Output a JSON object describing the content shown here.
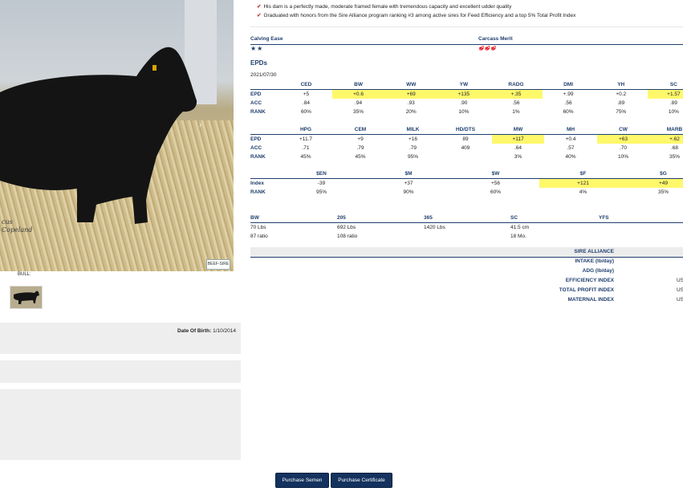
{
  "photo": {
    "caption_line1": "cus",
    "caption_line2": "Copeland",
    "logo_text": "BEEF-SIRE"
  },
  "left": {
    "bull_label": "BULL:",
    "dob_label": "Date Of Birth:",
    "dob_value": "1/10/2014"
  },
  "bullets": [
    "His dam is a perfectly made, moderate framed female with tremendous capacity and excellent udder quality",
    "Graduated with honors from the Sire Alliance program ranking #3 among active sires for Feed Efficiency and a top 5% Total Profit Index"
  ],
  "ratings": {
    "calving_ease_label": "Calving Ease",
    "calving_ease_stars": "★★",
    "carcass_merit_label": "Carcass Merit",
    "carcass_merit_icons": "🥩🥩🥩"
  },
  "epds": {
    "title": "EPDs",
    "date": "2021/07/30",
    "table1": {
      "headers": [
        "",
        "CED",
        "BW",
        "WW",
        "YW",
        "RADG",
        "DMI",
        "YH",
        "SC"
      ],
      "rows": [
        [
          "EPD",
          "+5",
          "+0.6",
          "+69",
          "+135",
          "+.35",
          "+.99",
          "+0.2",
          "+1.57"
        ],
        [
          "ACC",
          ".84",
          ".94",
          ".93",
          ".90",
          ".56",
          ".56",
          ".89",
          ".89"
        ],
        [
          "RANK",
          "60%",
          "35%",
          "20%",
          "10%",
          "1%",
          "60%",
          "75%",
          "10%"
        ]
      ]
    },
    "table2": {
      "headers": [
        "",
        "HPG",
        "CEM",
        "MILK",
        "HD/DTS",
        "MW",
        "MH",
        "CW",
        "MARB"
      ],
      "rows": [
        [
          "EPD",
          "+11.7",
          "+9",
          "+16",
          "89",
          "+117",
          "+0.4",
          "+63",
          "+.62"
        ],
        [
          "ACC",
          ".71",
          ".79",
          ".79",
          "409",
          ".64",
          ".57",
          ".70",
          ".68"
        ],
        [
          "RANK",
          "45%",
          "45%",
          "95%",
          "",
          "3%",
          "40%",
          "10%",
          "35%"
        ]
      ]
    },
    "table3": {
      "headers": [
        "",
        "$EN",
        "$M",
        "$W",
        "$F",
        "$G"
      ],
      "rows": [
        [
          "Index",
          "-39",
          "+37",
          "+56",
          "+121",
          "+49"
        ],
        [
          "RANK",
          "95%",
          "90%",
          "60%",
          "4%",
          "35%"
        ]
      ]
    }
  },
  "measures": {
    "headers": [
      "BW",
      "205",
      "365",
      "SC",
      "YFS"
    ],
    "row1": [
      "70 Lbs",
      "692 Lbs",
      "1420 Lbs",
      "41.5 cm",
      ""
    ],
    "row2": [
      "87 ratio",
      "108 ratio",
      "",
      "18 Mo.",
      ""
    ]
  },
  "sire_alliance": {
    "title": "SIRE ALLIANCE",
    "rows": [
      {
        "label": "INTAKE (lb/day)",
        "value": ""
      },
      {
        "label": "ADG (lb/day)",
        "value": ""
      },
      {
        "label": "EFFICIENCY INDEX",
        "value": "US"
      },
      {
        "label": "TOTAL PROFIT INDEX",
        "value": "US"
      },
      {
        "label": "MATERNAL INDEX",
        "value": "US"
      }
    ]
  },
  "buttons": {
    "semen": "Purchase Semen",
    "certificate": "Purchase Certificate"
  },
  "colors": {
    "accent": "#1f3f6e",
    "highlight": "#fff86b",
    "check": "#c0392b",
    "button": "#14325e"
  }
}
